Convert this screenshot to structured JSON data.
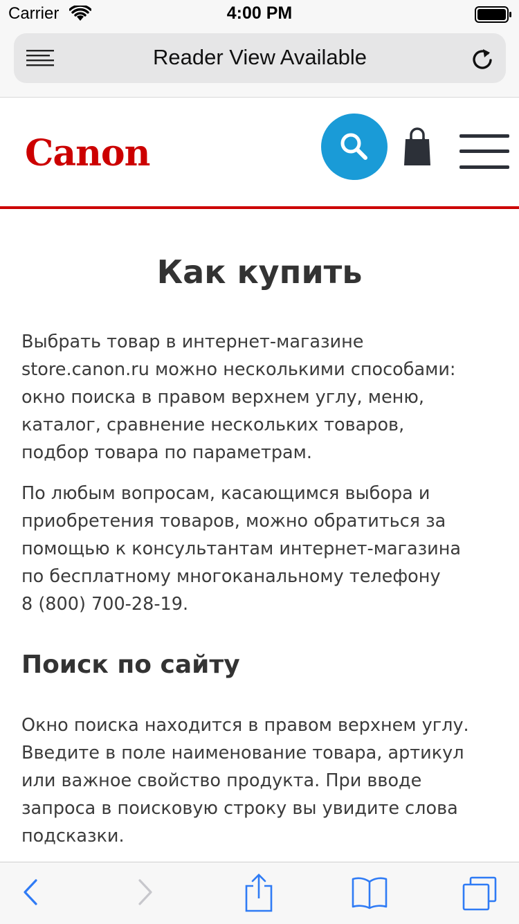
{
  "status_bar": {
    "carrier": "Carrier",
    "time": "4:00 PM",
    "wifi_icon": "wifi-icon",
    "battery_icon": "battery-icon"
  },
  "browser": {
    "reader_label": "Reader View Available",
    "reader_icon": "reader-lines-icon",
    "reload_icon": "reload-icon"
  },
  "header": {
    "logo_text": "Canon",
    "brand_color": "#cc0000",
    "search_color": "#1a9bd7",
    "search_icon": "search-icon",
    "cart_icon": "shopping-bag-icon",
    "menu_icon": "hamburger-menu-icon"
  },
  "main": {
    "title": "Как купить",
    "paragraph_1_lines": [
      "Выбрать товар в интернет-магазине",
      "store.canon.ru можно несколькими способами:",
      "окно поиска в правом верхнем углу, меню,",
      "каталог, сравнение нескольких товаров,",
      "подбор товара по параметрам."
    ],
    "paragraph_2_lines": [
      "По любым вопросам, касающимся выбора и",
      "приобретения товаров, можно обратиться за",
      "помощью к консультантам интернет-магазина",
      "по бесплатному многоканальному телефону",
      "8 (800) 700-28-19."
    ],
    "section_title": "Поиск по сайту",
    "paragraph_3_lines": [
      "Окно поиска находится в правом верхнем углу.",
      "Введите в поле наименование товара, артикул",
      "или важное свойство продукта. При вводе",
      "запроса в поисковую строку вы увидите слова",
      "подсказки."
    ]
  },
  "toolbar": {
    "back_icon": "back-arrow-icon",
    "forward_icon": "forward-arrow-icon",
    "share_icon": "share-icon",
    "bookmarks_icon": "bookmarks-book-icon",
    "tabs_icon": "tabs-icon",
    "accent_color": "#2f7bf5"
  }
}
